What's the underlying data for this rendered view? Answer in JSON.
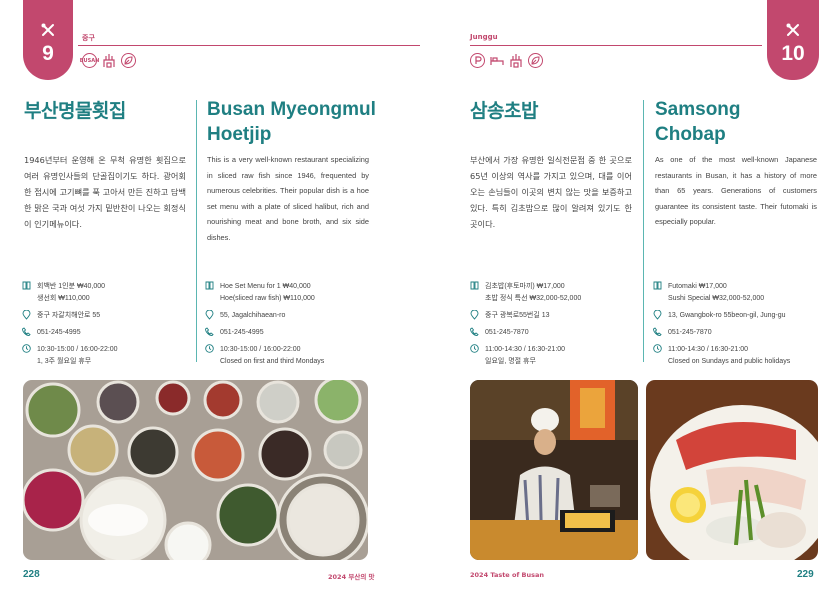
{
  "left": {
    "tab_number": "9",
    "district": "중구",
    "icon_badges": [
      "BUSAN",
      "",
      ""
    ],
    "title_ko": "부산명물횟집",
    "title_en": "Busan Myeongmul Hoetjip",
    "desc_ko": "1946년부터 운영해 온 무척 유명한 횟집으로 여러 유명인사들의 단골집이기도 하다. 광어회 한 접시에 고기뼈를 푹 고아서 만든 진하고 담백한 맑은 국과 여섯 가지 밑반찬이 나오는 회정식이 인기메뉴이다.",
    "desc_en": "This is a very well-known restaurant specializing in sliced raw fish since 1946, frequented by numerous celebrities. Their popular dish is a hoe set menu with a plate of sliced halibut, rich and nourishing meat and bone broth, and six side dishes.",
    "info_ko": {
      "menu": [
        "회백반 1인분 ₩40,000",
        "생선회 ₩110,000"
      ],
      "address": "중구 자갈치해안로 55",
      "phone": "051-245-4995",
      "hours": [
        "10:30-15:00 / 16:00-22:00",
        "1, 3주 월요일 휴무"
      ]
    },
    "info_en": {
      "menu": [
        "Hoe Set Menu for 1  ₩40,000",
        "Hoe(sliced raw fish)  ₩110,000"
      ],
      "address": "55, Jagalchihaean-ro",
      "phone": "051-245-4995",
      "hours": [
        "10:30-15:00 / 16:00-22:00",
        "Closed on first and third Mondays"
      ]
    },
    "page_number": "228",
    "footer": "2024 부산의 맛"
  },
  "right": {
    "tab_number": "10",
    "district": "Junggu",
    "title_ko": "삼송초밥",
    "title_en": "Samsong Chobap",
    "desc_ko": "부산에서 가장 유명한 일식전문점 중 한 곳으로 65년 이상의 역사를 가지고 있으며, 대를 이어 오는 손님들이 이곳의 변치 않는 맛을 보증하고 있다. 특히 김초밥으로 많이 알려져 있기도 한 곳이다.",
    "desc_en": "As one of the most well-known Japanese restaurants in Busan, it has a history of more than 65 years. Generations of customers guarantee its consistent taste. Their futomaki is especially popular.",
    "info_ko": {
      "menu": [
        "김초밥(후토마끼) ₩17,000",
        "초밥 정식 특선 ₩32,000-52,000"
      ],
      "address": "중구 광복로55번길 13",
      "phone": "051-245-7870",
      "hours": [
        "11:00-14:30 / 16:30-21:00",
        "일요일, 명절 휴무"
      ]
    },
    "info_en": {
      "menu": [
        "Futomaki  ₩17,000",
        "Sushi Special  ₩32,000-52,000"
      ],
      "address": "13, Gwangbok-ro 55beon-gil, Jung-gu",
      "phone": "051-245-7870",
      "hours": [
        "11:00-14:30 / 16:30-21:00",
        "Closed on Sundays and public holidays"
      ]
    },
    "page_number": "229",
    "footer": "2024 Taste of Busan"
  },
  "colors": {
    "accent": "#c2486e",
    "title": "#1f7f82",
    "divider": "#5bb6b2"
  },
  "icons": [
    "fork-knife-icon",
    "menu-book-icon",
    "pin-icon",
    "phone-icon",
    "clock-icon"
  ]
}
